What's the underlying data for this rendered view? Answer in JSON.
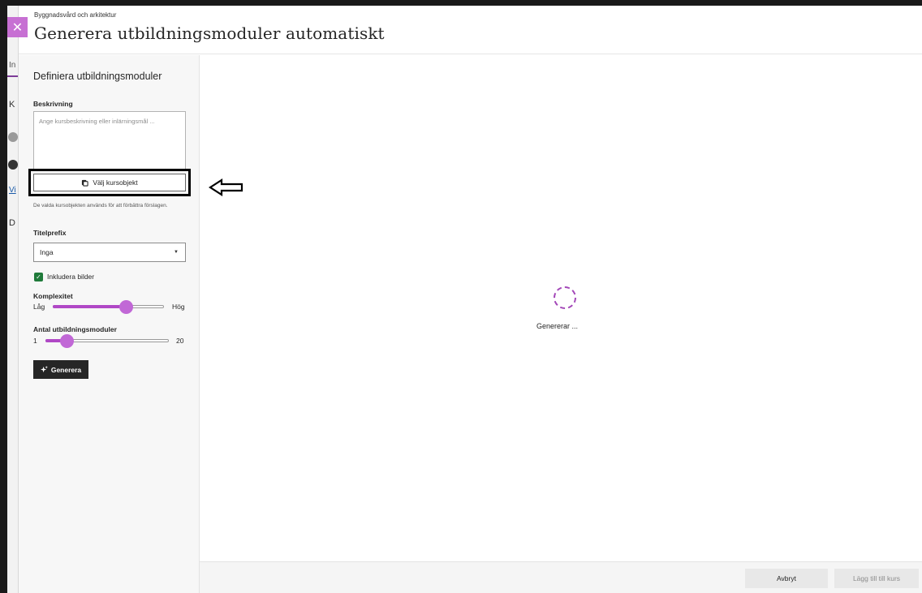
{
  "background_page": {
    "fragments": [
      "In",
      "K",
      "Vi",
      "D"
    ]
  },
  "header": {
    "breadcrumb": "Byggnadsvård och arkitektur",
    "title": "Generera utbildningsmoduler automatiskt",
    "close_icon": "close-icon"
  },
  "panel": {
    "title": "Definiera utbildningsmoduler",
    "description": {
      "label": "Beskrivning",
      "placeholder": "Ange kursbeskrivning eller inlärningsmål ..."
    },
    "select_objects": {
      "label": "Välj kursobjekt",
      "icon": "copy-icon",
      "hint": "De valda kursobjekten används för att förbättra förslagen."
    },
    "title_prefix": {
      "label": "Titelprefix",
      "value": "Inga"
    },
    "include_images": {
      "label": "Inkludera bilder",
      "checked": true
    },
    "complexity": {
      "label": "Komplexitet",
      "min_label": "Låg",
      "max_label": "Hög",
      "value": 0.66
    },
    "module_count": {
      "label": "Antal utbildningsmoduler",
      "min_label": "1",
      "max_label": "20",
      "value": 0.17
    },
    "generate_button": {
      "label": "Generera",
      "icon": "sparkle-icon"
    }
  },
  "main": {
    "loading_text": "Genererar ..."
  },
  "footer": {
    "cancel": "Avbryt",
    "add_to_course": "Lägg till till kurs"
  },
  "colors": {
    "accent": "#c168d6",
    "close_button": "#c770d3",
    "checkbox": "#1f7a3a",
    "dark_button": "#262626"
  }
}
